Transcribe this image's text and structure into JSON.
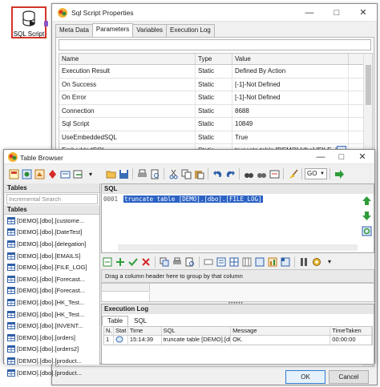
{
  "node": {
    "label": "SQL Script"
  },
  "dialog": {
    "title": "Sql Script Properties",
    "tabs": [
      "Meta Data",
      "Parameters",
      "Variables",
      "Execution Log"
    ],
    "active_tab": "Parameters",
    "columns": [
      "Name",
      "Type",
      "Value"
    ],
    "rows": [
      {
        "name": "Execution Result",
        "type": "Static",
        "value": "Defined By Action"
      },
      {
        "name": "On Success",
        "type": "Static",
        "value": "[-1]-Not Defined"
      },
      {
        "name": "On Error",
        "type": "Static",
        "value": "[-1]-Not Defined"
      },
      {
        "name": "Connection",
        "type": "Static",
        "value": "8688"
      },
      {
        "name": "Sql Script",
        "type": "Static",
        "value": "10849"
      },
      {
        "name": "UseEmbeddedSQL",
        "type": "Static",
        "value": "True"
      },
      {
        "name": "EmbeddedSQL",
        "type": "Static",
        "value": "truncate table [DEMO].[dbo].[FILE_LOG]"
      }
    ],
    "ok_label": "OK",
    "cancel_label": "Cancel"
  },
  "table_browser": {
    "title": "Table Browser",
    "go_combo": "GO",
    "tables_header": "Tables",
    "search_placeholder": "Incremental Search",
    "tables": [
      "[DEMO].[dbo].[custome...",
      "[DEMO].[dbo].[DateTest]",
      "[DEMO].[dbo].[delegation]",
      "[DEMO].[dbo].[EMAILS]",
      "[DEMO].[dbo].[FILE_LOG]",
      "[DEMO].[dbo].[Forecast...",
      "[DEMO].[dbo].[Forecast...",
      "[DEMO].[dbo].[HK_Test...",
      "[DEMO].[dbo].[HK_Test...",
      "[DEMO].[dbo].[INVENT...",
      "[DEMO].[dbo].[orders]",
      "[DEMO].[dbo].[orders2]",
      "[DEMO].[dbo].[product...",
      "[DEMO].[dbo].[product..."
    ],
    "sql_header": "SQL",
    "sql_line_no": "0001",
    "sql_text": "truncate table [DEMO].[dbo].[FILE_LOG]",
    "group_hint": "Drag a column header here to group by that column",
    "exec_header": "Execution Log",
    "exec_tabs": [
      "Table",
      "SQL"
    ],
    "log_columns": [
      "N.",
      "Stat",
      "Time",
      "SQL",
      "Message",
      "TimeTaken"
    ],
    "log_rows": [
      {
        "n": "1",
        "time": "15:14:39",
        "sql": "truncate table [DEMO].[dl",
        "message": "OK.",
        "time_taken": "00:00:00"
      }
    ]
  }
}
